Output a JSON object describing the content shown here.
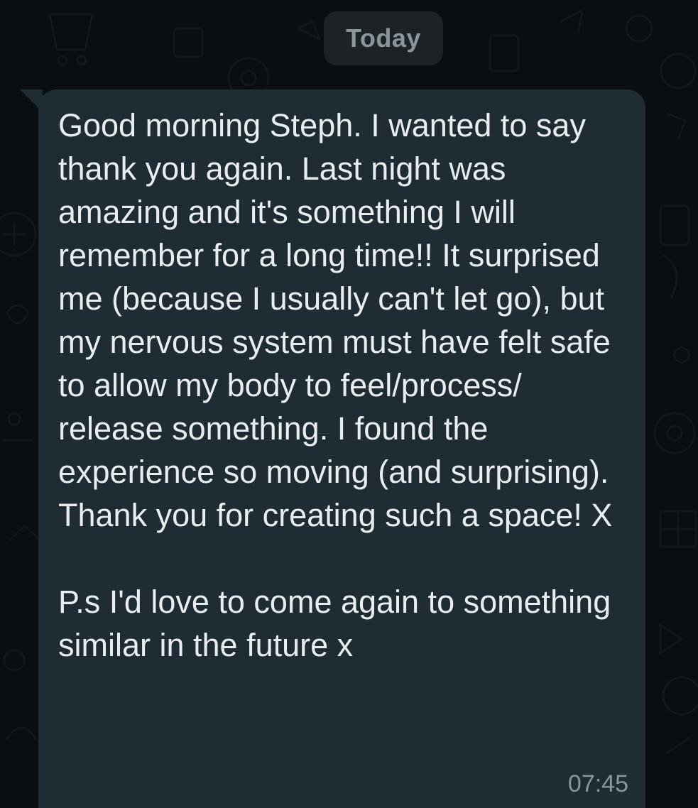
{
  "chat": {
    "date_separator": "Today",
    "messages": [
      {
        "text": "Good morning Steph. I wanted to say thank you again. Last night was amazing and it's something I will remember for a long time!! It surprised me (because I usually can't let go), but my nervous system must have felt safe to allow my body to feel/process/ release something. I found the experience so moving (and surprising). Thank you for creating such a space! X\n\nP.s I'd love to come again to something similar in the future x",
        "time": "07:45",
        "direction": "incoming"
      }
    ]
  },
  "colors": {
    "background": "#0b0e10",
    "bubble_incoming": "#202c33",
    "date_chip": "#1c2225",
    "text_primary": "#e9edef",
    "text_secondary": "#8a969c"
  }
}
